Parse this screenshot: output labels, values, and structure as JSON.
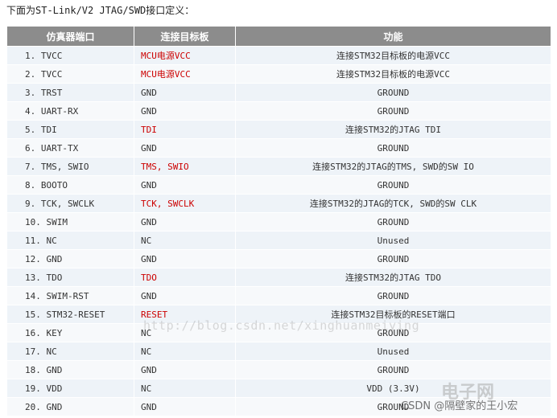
{
  "intro": "下面为ST-Link/V2 JTAG/SWD接口定义：",
  "headers": [
    "仿真器端口",
    "连接目标板",
    "功能"
  ],
  "rows": [
    {
      "port": "1.  TVCC",
      "target": "MCU电源VCC",
      "target_red": true,
      "func": "连接STM32目标板的电源VCC"
    },
    {
      "port": "2.  TVCC",
      "target": "MCU电源VCC",
      "target_red": true,
      "func": "连接STM32目标板的电源VCC"
    },
    {
      "port": "3.  TRST",
      "target": "GND",
      "target_red": false,
      "func": "GROUND"
    },
    {
      "port": "4.  UART-RX",
      "target": "GND",
      "target_red": false,
      "func": "GROUND"
    },
    {
      "port": "5.  TDI",
      "target": "TDI",
      "target_red": true,
      "func": "连接STM32的JTAG TDI"
    },
    {
      "port": "6.  UART-TX",
      "target": "GND",
      "target_red": false,
      "func": "GROUND"
    },
    {
      "port": "7.  TMS, SWIO",
      "target": "TMS, SWIO",
      "target_red": true,
      "func": "连接STM32的JTAG的TMS, SWD的SW IO"
    },
    {
      "port": "8.  BOOTO",
      "target": "GND",
      "target_red": false,
      "func": "GROUND"
    },
    {
      "port": "9.  TCK, SWCLK",
      "target": "TCK, SWCLK",
      "target_red": true,
      "func": "连接STM32的JTAG的TCK, SWD的SW CLK"
    },
    {
      "port": "10.  SWIM",
      "target": "GND",
      "target_red": false,
      "func": "GROUND"
    },
    {
      "port": "11.  NC",
      "target": "NC",
      "target_red": false,
      "func": "Unused"
    },
    {
      "port": "12.  GND",
      "target": "GND",
      "target_red": false,
      "func": "GROUND"
    },
    {
      "port": "13.  TDO",
      "target": "TDO",
      "target_red": true,
      "func": "连接STM32的JTAG TDO"
    },
    {
      "port": "14.  SWIM-RST",
      "target": "GND",
      "target_red": false,
      "func": "GROUND"
    },
    {
      "port": "15.  STM32-RESET",
      "target": "RESET",
      "target_red": true,
      "func": "连接STM32目标板的RESET端口"
    },
    {
      "port": "16.  KEY",
      "target": "NC",
      "target_red": false,
      "func": "GROUND"
    },
    {
      "port": "17.  NC",
      "target": "NC",
      "target_red": false,
      "func": "Unused"
    },
    {
      "port": "18.  GND",
      "target": "GND",
      "target_red": false,
      "func": "GROUND"
    },
    {
      "port": "19.  VDD",
      "target": "NC",
      "target_red": false,
      "func": "VDD (3.3V)"
    },
    {
      "port": "20.  GND",
      "target": "GND",
      "target_red": false,
      "func": "GROUND"
    }
  ],
  "watermark": "http://blog.csdn.net/xinghuanmeiying",
  "logo": "电子网",
  "csdn_credit": "CSDN @隔壁家的王小宏",
  "colors": {
    "header_bg": "#8c8c8c",
    "row_odd": "#eef3f8",
    "row_even": "#f7f9fb",
    "highlight": "#cc0000"
  }
}
